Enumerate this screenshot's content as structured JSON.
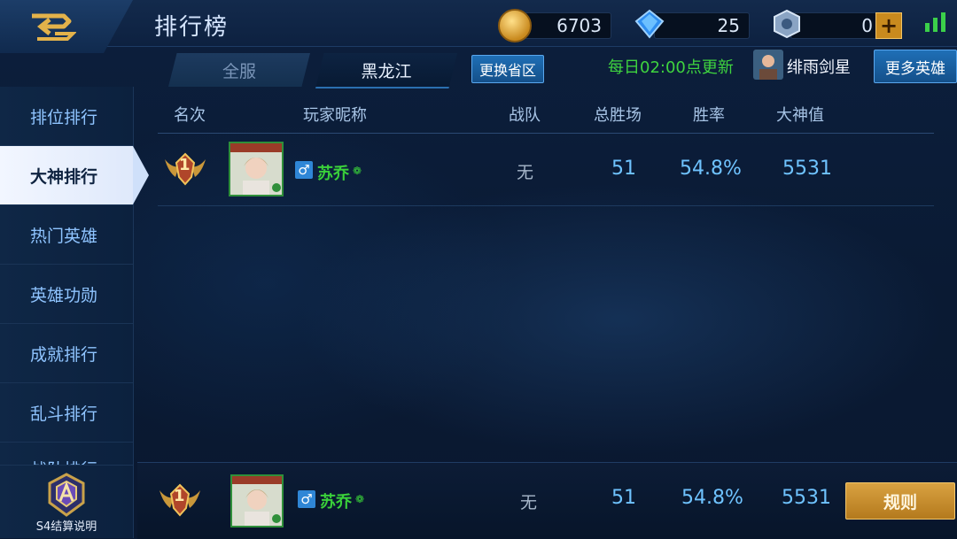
{
  "header": {
    "title": "排行榜",
    "gold": "6703",
    "diamonds": "25",
    "tickets": "0"
  },
  "tabs": [
    {
      "label": "全服"
    },
    {
      "label": "黑龙江"
    }
  ],
  "buttons": {
    "change_region": "更换省区",
    "more_heroes": "更多英雄",
    "rules": "规则"
  },
  "update_notice": "每日02:00点更新",
  "hero_name": "绯雨剑星",
  "sidebar": {
    "items": [
      {
        "label": "排位排行"
      },
      {
        "label": "大神排行"
      },
      {
        "label": "热门英雄"
      },
      {
        "label": "英雄功勋"
      },
      {
        "label": "成就排行"
      },
      {
        "label": "乱斗排行"
      },
      {
        "label": "战队排行"
      }
    ],
    "season_label": "S4结算说明"
  },
  "table": {
    "columns": [
      "名次",
      "玩家昵称",
      "战队",
      "总胜场",
      "胜率",
      "大神值"
    ],
    "rows": [
      {
        "rank": "1",
        "gender": "♂",
        "name": "苏乔",
        "team": "无",
        "wins": "51",
        "win_rate": "54.8%",
        "score": "5531"
      }
    ]
  },
  "self_row": {
    "rank": "1",
    "gender": "♂",
    "name": "苏乔",
    "team": "无",
    "wins": "51",
    "win_rate": "54.8%",
    "score": "5531"
  },
  "colors": {
    "accent_green": "#3ad13a",
    "value_blue": "#6fc3ff",
    "gold_button": "#d9a241"
  }
}
